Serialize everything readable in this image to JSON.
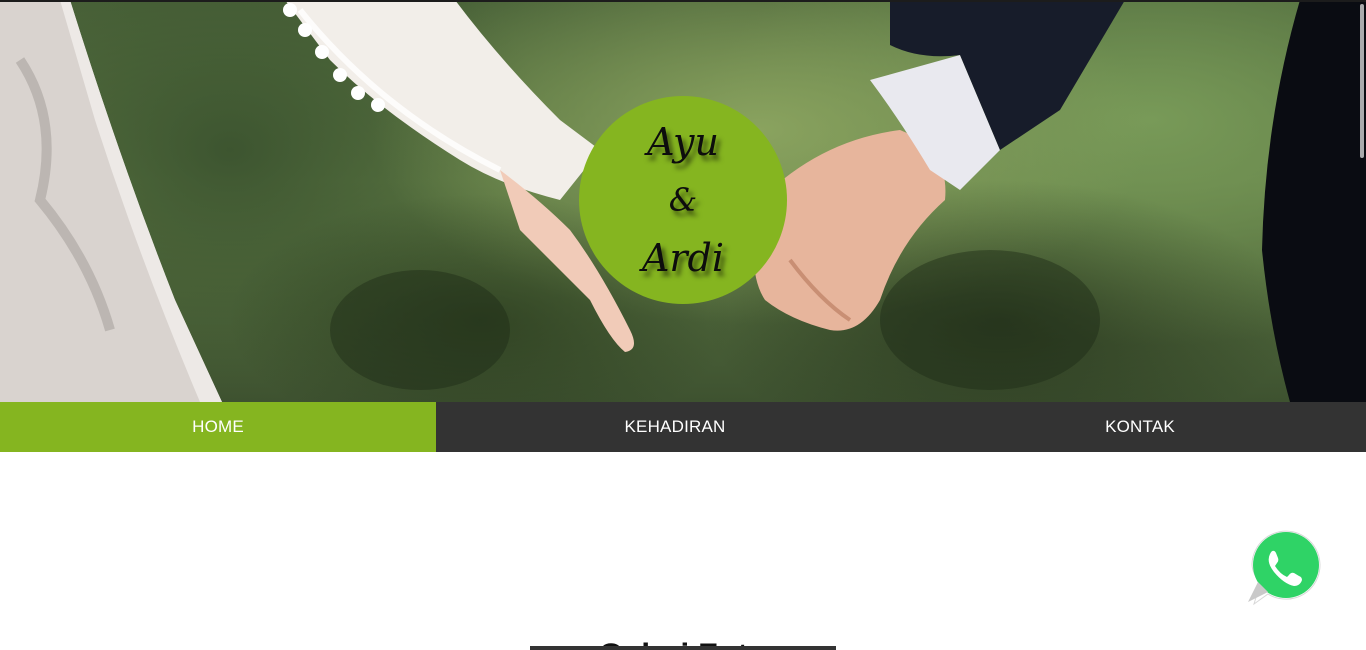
{
  "hero": {
    "names": {
      "bride": "Ayu",
      "ampersand": "&",
      "groom": "Ardi"
    },
    "circle_color": "#85b520"
  },
  "nav": {
    "items": [
      {
        "label": "HOME",
        "active": true
      },
      {
        "label": "KEHADIRAN",
        "active": false
      },
      {
        "label": "KONTAK",
        "active": false
      }
    ],
    "active_color": "#85b520",
    "bar_color": "#333333"
  },
  "floating": {
    "whatsapp_icon": "whatsapp-icon",
    "whatsapp_color": "#25d366"
  },
  "gallery": {
    "heading": "Galeri Foto"
  }
}
